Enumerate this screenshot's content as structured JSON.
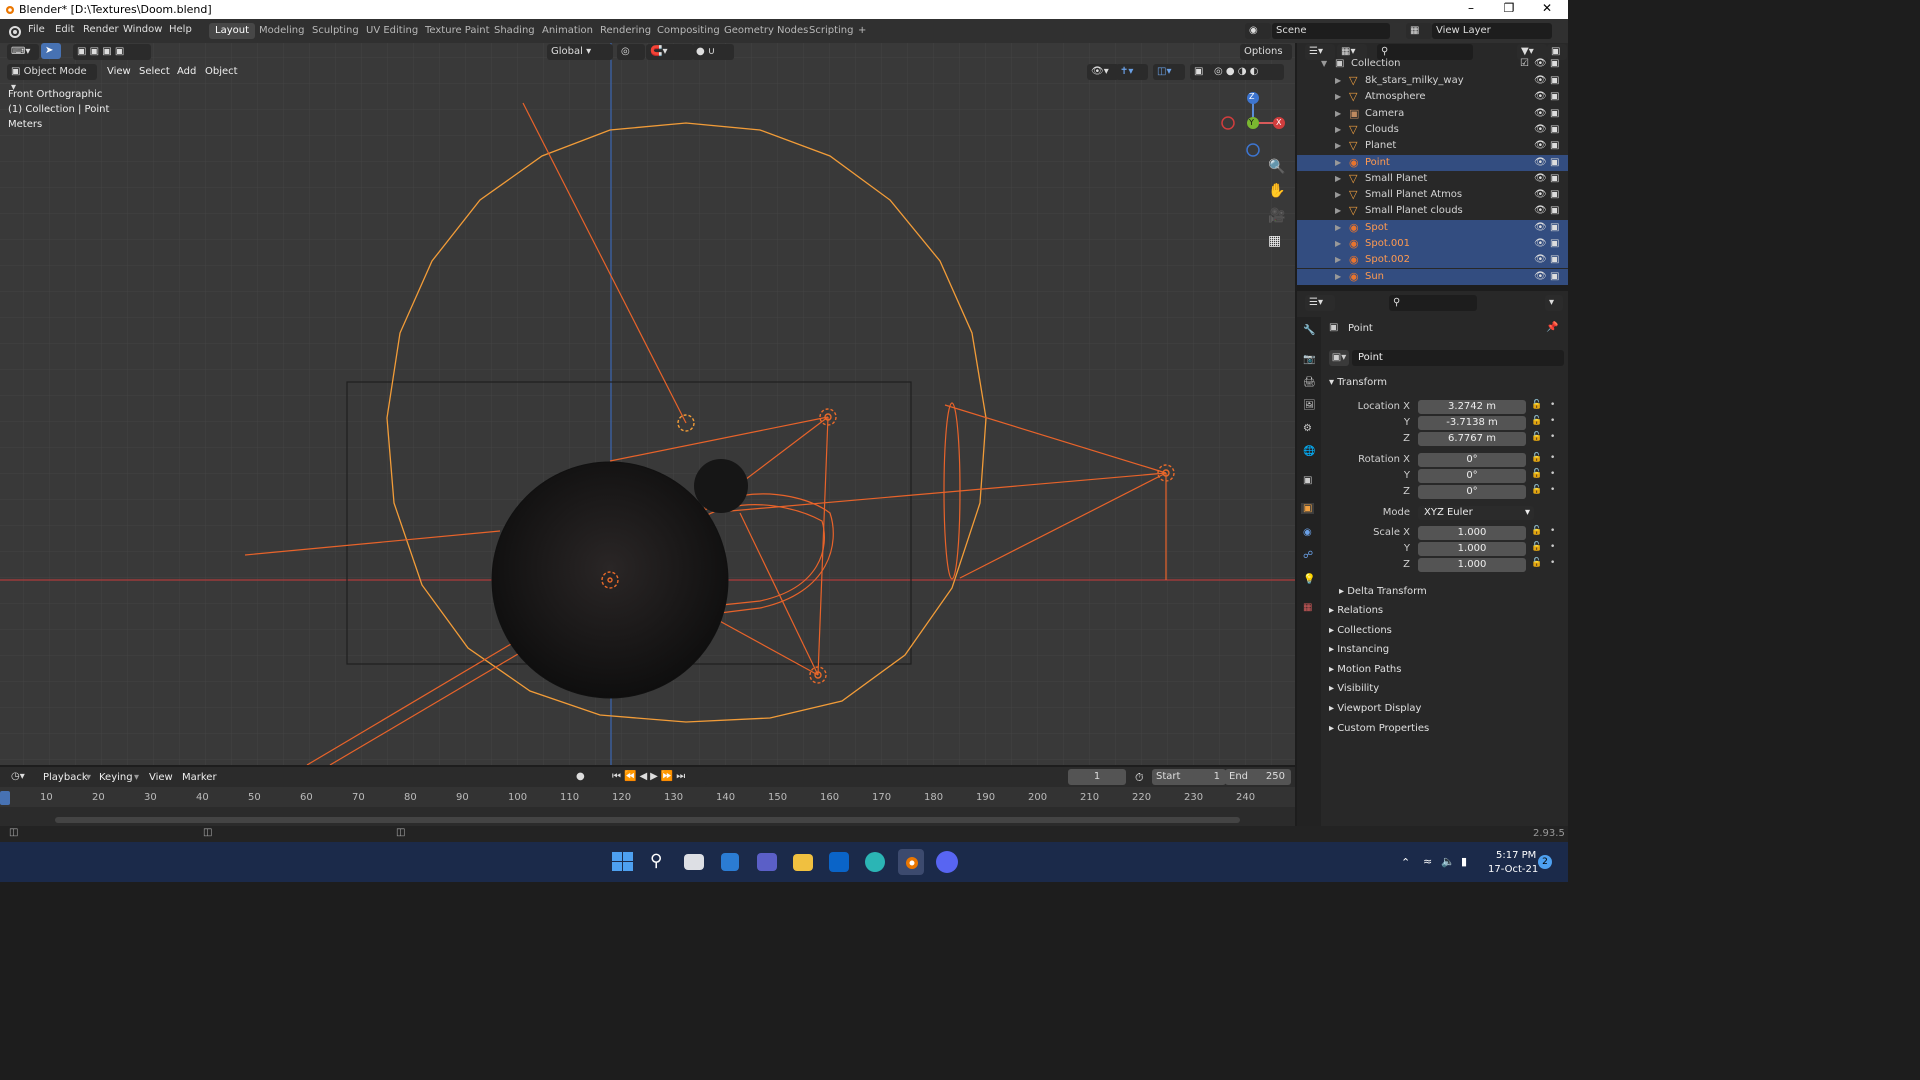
{
  "window": {
    "title": "Blender* [D:\\Textures\\Doom.blend]"
  },
  "menu": [
    "File",
    "Edit",
    "Render",
    "Window",
    "Help"
  ],
  "workspaces": [
    {
      "label": "Layout",
      "active": true
    },
    {
      "label": "Modeling"
    },
    {
      "label": "Sculpting"
    },
    {
      "label": "UV Editing"
    },
    {
      "label": "Texture Paint"
    },
    {
      "label": "Shading"
    },
    {
      "label": "Animation"
    },
    {
      "label": "Rendering"
    },
    {
      "label": "Compositing"
    },
    {
      "label": "Geometry Nodes"
    },
    {
      "label": "Scripting"
    },
    {
      "label": "+"
    }
  ],
  "topright": {
    "scene": "Scene",
    "view_layer": "View Layer"
  },
  "viewport": {
    "transform_orientation": "Global",
    "options": "Options",
    "mode": "Object Mode",
    "menus": [
      "View",
      "Select",
      "Add",
      "Object"
    ],
    "overlay_text": [
      "Front Orthographic",
      "(1) Collection | Point",
      "Meters"
    ],
    "gizmo": {
      "z": "Z",
      "y": "Y",
      "x": "X"
    }
  },
  "outliner": {
    "collection": "Collection",
    "items": [
      {
        "name": "8k_stars_milky_way",
        "type": "mesh",
        "selected": false
      },
      {
        "name": "Atmosphere",
        "type": "mesh",
        "selected": false
      },
      {
        "name": "Camera",
        "type": "camera",
        "selected": false
      },
      {
        "name": "Clouds",
        "type": "mesh",
        "selected": false
      },
      {
        "name": "Planet",
        "type": "mesh",
        "selected": false
      },
      {
        "name": "Point",
        "type": "light",
        "selected": true
      },
      {
        "name": "Small Planet",
        "type": "mesh",
        "selected": false
      },
      {
        "name": "Small Planet Atmos",
        "type": "mesh",
        "selected": false
      },
      {
        "name": "Small Planet clouds",
        "type": "mesh",
        "selected": false
      },
      {
        "name": "Spot",
        "type": "light",
        "selected": true
      },
      {
        "name": "Spot.001",
        "type": "light",
        "selected": true
      },
      {
        "name": "Spot.002",
        "type": "light",
        "selected": true
      },
      {
        "name": "Sun",
        "type": "light",
        "selected": true
      }
    ]
  },
  "properties": {
    "object_name": "Point",
    "name_field": "Point",
    "transform_label": "Transform",
    "location": {
      "label_x": "Location X",
      "label_y": "Y",
      "label_z": "Z",
      "x": "3.2742 m",
      "y": "-3.7138 m",
      "z": "6.7767 m"
    },
    "rotation": {
      "label_x": "Rotation X",
      "label_y": "Y",
      "label_z": "Z",
      "x": "0°",
      "y": "0°",
      "z": "0°"
    },
    "mode_label": "Mode",
    "mode_value": "XYZ Euler",
    "scale": {
      "label_x": "Scale X",
      "label_y": "Y",
      "label_z": "Z",
      "x": "1.000",
      "y": "1.000",
      "z": "1.000"
    },
    "delta": "Delta Transform",
    "panels": [
      "Relations",
      "Collections",
      "Instancing",
      "Motion Paths",
      "Visibility",
      "Viewport Display",
      "Custom Properties"
    ]
  },
  "timeline": {
    "menus": [
      "Playback",
      "Keying",
      "View",
      "Marker"
    ],
    "current_frame": "1",
    "start_label": "Start",
    "start": "1",
    "end_label": "End",
    "end": "250",
    "ticks": [
      "10",
      "20",
      "30",
      "40",
      "50",
      "60",
      "70",
      "80",
      "90",
      "100",
      "110",
      "120",
      "130",
      "140",
      "150",
      "160",
      "170",
      "180",
      "190",
      "200",
      "210",
      "220",
      "230",
      "240"
    ]
  },
  "status": {
    "version": "2.93.5"
  },
  "taskbar": {
    "time": "5:17 PM",
    "date": "17-Oct-21",
    "notifications": "2"
  }
}
